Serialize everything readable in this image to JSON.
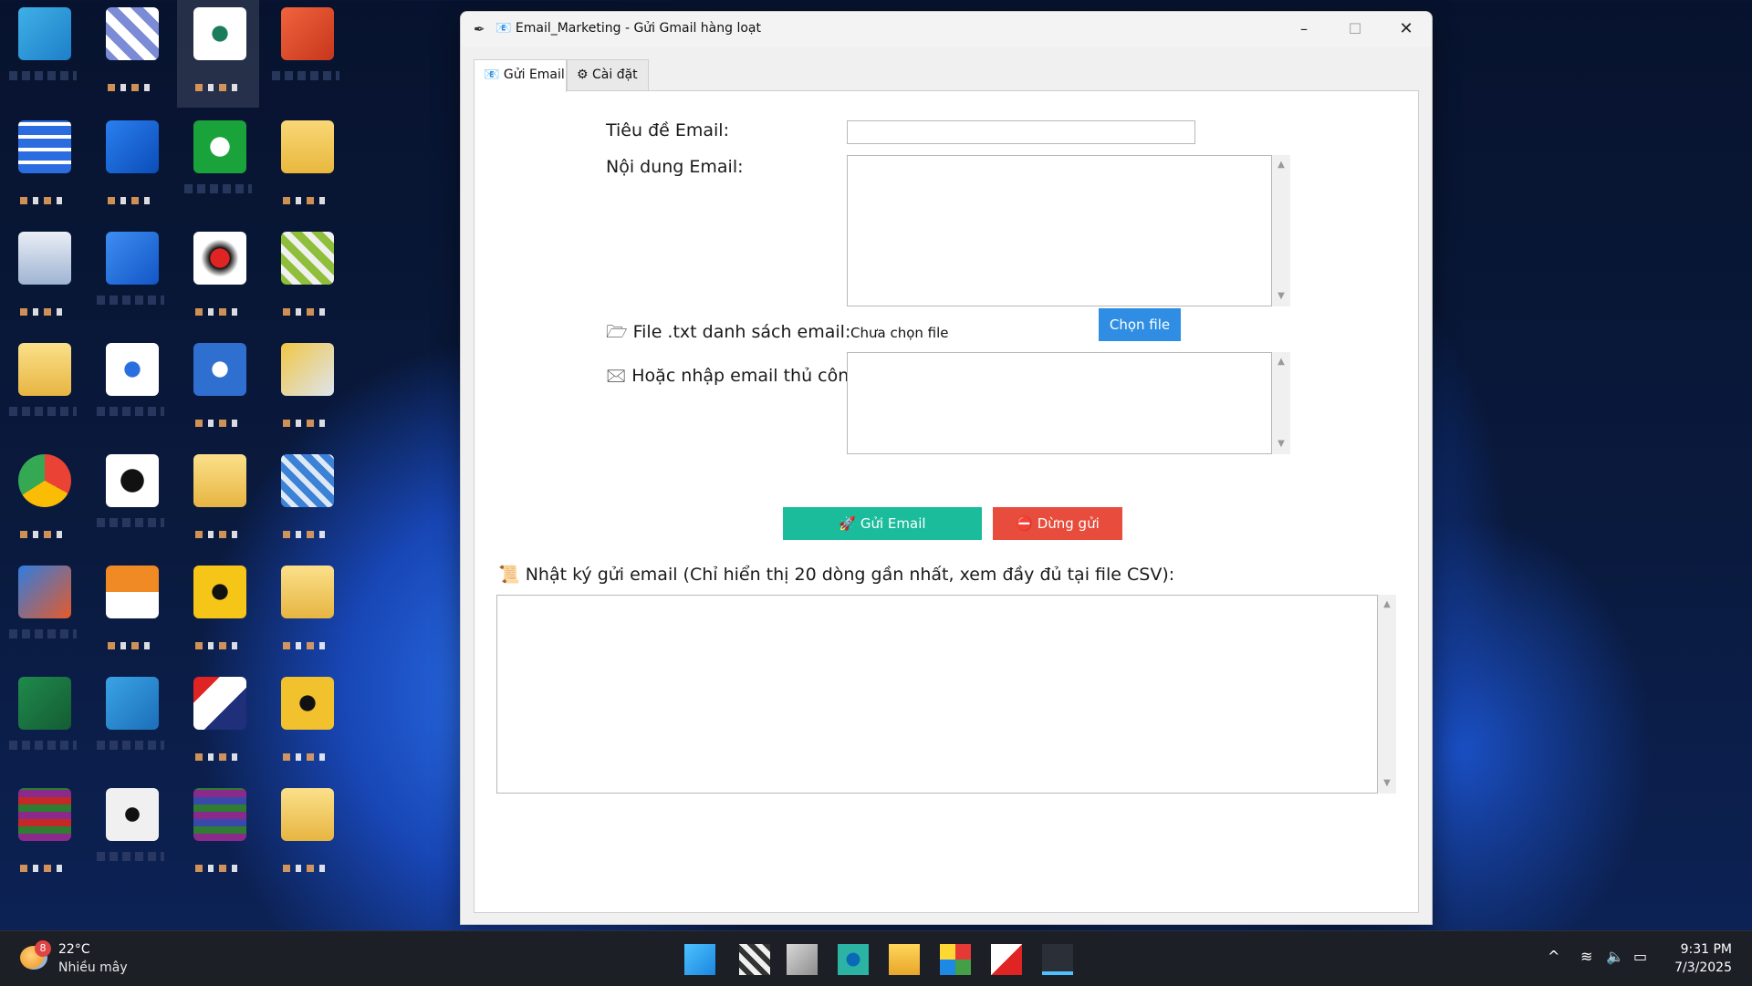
{
  "window": {
    "title": "📧 Email_Marketing - Gửi Gmail hàng loạt",
    "app_icon": "feather-icon",
    "controls": {
      "minimize": "–",
      "maximize": "☐",
      "close": "✕"
    }
  },
  "tabs": [
    {
      "label": "📧 Gửi Email",
      "active": true
    },
    {
      "label": "⚙ Cài đặt",
      "active": false
    }
  ],
  "form": {
    "subject_label": "Tiêu đề Email:",
    "subject_value": "",
    "body_label": "Nội dung Email:",
    "body_value": "",
    "file_label": "🗁 File .txt danh sách email:",
    "file_status": "Chưa chọn file",
    "choose_file_button": "Chọn file",
    "manual_label": "🖂 Hoặc nhập email thủ công:",
    "manual_value": ""
  },
  "actions": {
    "send_button": "🚀 Gửi Email",
    "stop_button": "⛔ Dừng gửi"
  },
  "log": {
    "label": "📜 Nhật ký gửi email (Chỉ hiển thị 20 dòng gần nhất, xem đầy đủ tại file CSV):",
    "content": ""
  },
  "taskbar": {
    "weather_temp": "22°C",
    "weather_condition": "Nhiều mây",
    "weather_badge": "8",
    "time": "9:31 PM",
    "date": "7/3/2025",
    "tray_icons": [
      "chevron-up-icon",
      "wifi-icon",
      "volume-icon",
      "battery-icon"
    ]
  },
  "colors": {
    "send_button": "#1abc9c",
    "stop_button": "#e74c3c",
    "choose_file_button": "#2f8ee4"
  }
}
